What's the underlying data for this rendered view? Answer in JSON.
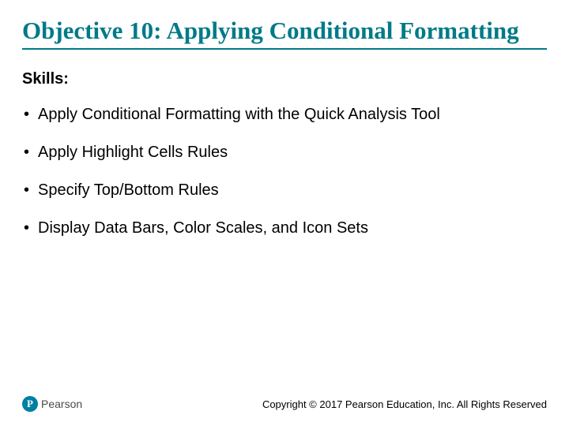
{
  "title": "Objective 10: Applying Conditional Formatting",
  "skills_label": "Skills:",
  "skills": {
    "items": [
      "Apply Conditional Formatting with the Quick Analysis Tool",
      "Apply Highlight Cells Rules",
      "Specify Top/Bottom Rules",
      "Display Data Bars, Color Scales, and Icon Sets"
    ]
  },
  "logo": {
    "mark": "P",
    "text": "Pearson"
  },
  "copyright": "Copyright © 2017 Pearson Education, Inc. All Rights Reserved"
}
